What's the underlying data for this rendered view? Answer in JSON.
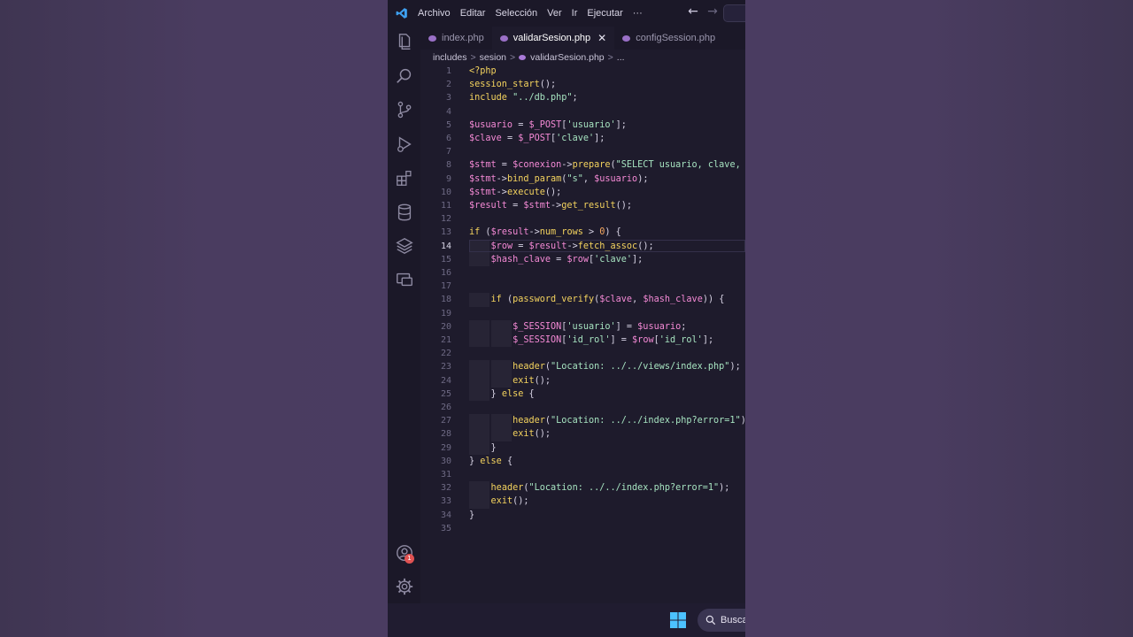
{
  "menu": {
    "items": [
      "Archivo",
      "Editar",
      "Selección",
      "Ver",
      "Ir",
      "Ejecutar",
      "···"
    ]
  },
  "nav": {
    "back": "←",
    "forward": "→"
  },
  "tabs": [
    {
      "label": "index.php",
      "active": false
    },
    {
      "label": "validarSesion.php",
      "active": true,
      "close": "✕"
    },
    {
      "label": "configSession.php",
      "active": false
    }
  ],
  "breadcrumb": {
    "parts": [
      "includes",
      "sesion",
      "validarSesion.php",
      "..."
    ],
    "separator": ">"
  },
  "editor": {
    "current_line": 14,
    "line_numbers": [
      "1",
      "2",
      "3",
      "4",
      "5",
      "6",
      "7",
      "8",
      "9",
      "10",
      "11",
      "12",
      "13",
      "14",
      "15",
      "16",
      "17",
      "18",
      "19",
      "20",
      "21",
      "22",
      "23",
      "24",
      "25",
      "26",
      "27",
      "28",
      "29",
      "30",
      "31",
      "32",
      "33",
      "34",
      "35"
    ],
    "lines": [
      "<?php",
      "session_start();",
      "include \"../db.php\";",
      "",
      "$usuario = $_POST['usuario'];",
      "$clave = $_POST['clave'];",
      "",
      "$stmt = $conexion->prepare(\"SELECT usuario, clave,",
      "$stmt->bind_param(\"s\", $usuario);",
      "$stmt->execute();",
      "$result = $stmt->get_result();",
      "",
      "if ($result->num_rows > 0) {",
      "    $row = $result->fetch_assoc();",
      "    $hash_clave = $row['clave'];",
      "",
      "",
      "    if (password_verify($clave, $hash_clave)) {",
      "",
      "        $_SESSION['usuario'] = $usuario;",
      "        $_SESSION['id_rol'] = $row['id_rol'];",
      "",
      "        header(\"Location: ../../views/index.php\");",
      "        exit();",
      "    } else {",
      "",
      "        header(\"Location: ../../index.php?error=1\")",
      "        exit();",
      "    }",
      "} else {",
      "",
      "    header(\"Location: ../../index.php?error=1\");",
      "    exit();",
      "}",
      ""
    ]
  },
  "activity": {
    "icons": [
      "explorer-icon",
      "search-icon",
      "source-control-icon",
      "run-debug-icon",
      "extensions-icon",
      "database-icon",
      "layers-icon",
      "remote-icon",
      "account-icon",
      "gear-icon"
    ],
    "badge": "1"
  },
  "taskbar": {
    "search_label": "Busca"
  },
  "colors": {
    "keyword": "#f4d35e",
    "variable": "#f58ad6",
    "string": "#a6e3c0",
    "number": "#f7a860",
    "background": "#1e1b2c"
  }
}
